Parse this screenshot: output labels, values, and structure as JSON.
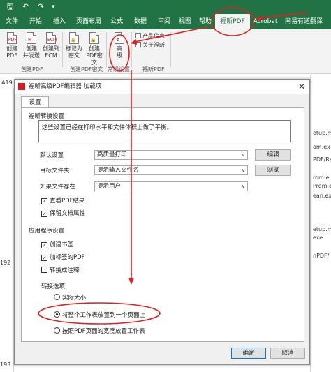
{
  "toolbar": {
    "file_icon": "save-icon",
    "undo_icon": "undo-icon",
    "redo_icon": "redo-icon"
  },
  "tabs": [
    "文件",
    "开始",
    "插入",
    "页面布局",
    "公式",
    "数据",
    "审阅",
    "视图",
    "帮助",
    "福昕PDF",
    "Acrobat",
    "网易有道翻译"
  ],
  "ribbon": {
    "create_pdf": "创建\nPDF",
    "create_send": "创建\n并发送",
    "create_ecm": "创建到\nECM",
    "group_create_pdf": "创建PDF",
    "mark_doc": "标记为\n密文",
    "create_pdf_doc": "创建PDF密\n文",
    "group_create_pdf_doc": "创建PDF密文",
    "advanced": "高\n级",
    "group_general": "常规设置",
    "product_info": "产品信息",
    "about_foxit": "关于福昕",
    "group_foxit": "福昕PDF"
  },
  "sheet": {
    "namebox": "A19",
    "row_a": "192",
    "row_b": "193",
    "side_lines": [
      "etup.m",
      "om.ex",
      "PDF/Rea",
      "rom.e",
      "Prom.e",
      "ean.ex",
      "etup.m",
      "exe",
      "nPDF/"
    ]
  },
  "dialog": {
    "title": "福昕高级PDF编辑器 加载项",
    "tab": "设置",
    "section_foxit": "福昕转换设置",
    "description": "这些设置已经在打印水平和文件体积上做了平衡。",
    "default_label": "默认设置",
    "default_value": "高质量打印",
    "edit_button": "编辑",
    "target_label": "目标文件夹",
    "target_value": "提示输入文件名",
    "browse_button": "浏览",
    "exists_label": "如果文件存在",
    "exists_value": "提示用户",
    "view_result": "查看PDF结果",
    "keep_props": "保留文档属性",
    "section_app": "应用程序设置",
    "create_bookmarks": "创建书签",
    "add_tags": "加标签的PDF",
    "convert_comments": "转换成注释",
    "convert_options": "转换选项:",
    "actual_size": "实际大小",
    "fit_one_page": "将整个工作表放置到一个页面上",
    "fit_width": "按照PDF页面的宽度放置工作表",
    "ok_button": "确定",
    "cancel_button": "取消"
  },
  "colors": {
    "excel_green": "#217346",
    "annotation_red": "#e02020"
  }
}
